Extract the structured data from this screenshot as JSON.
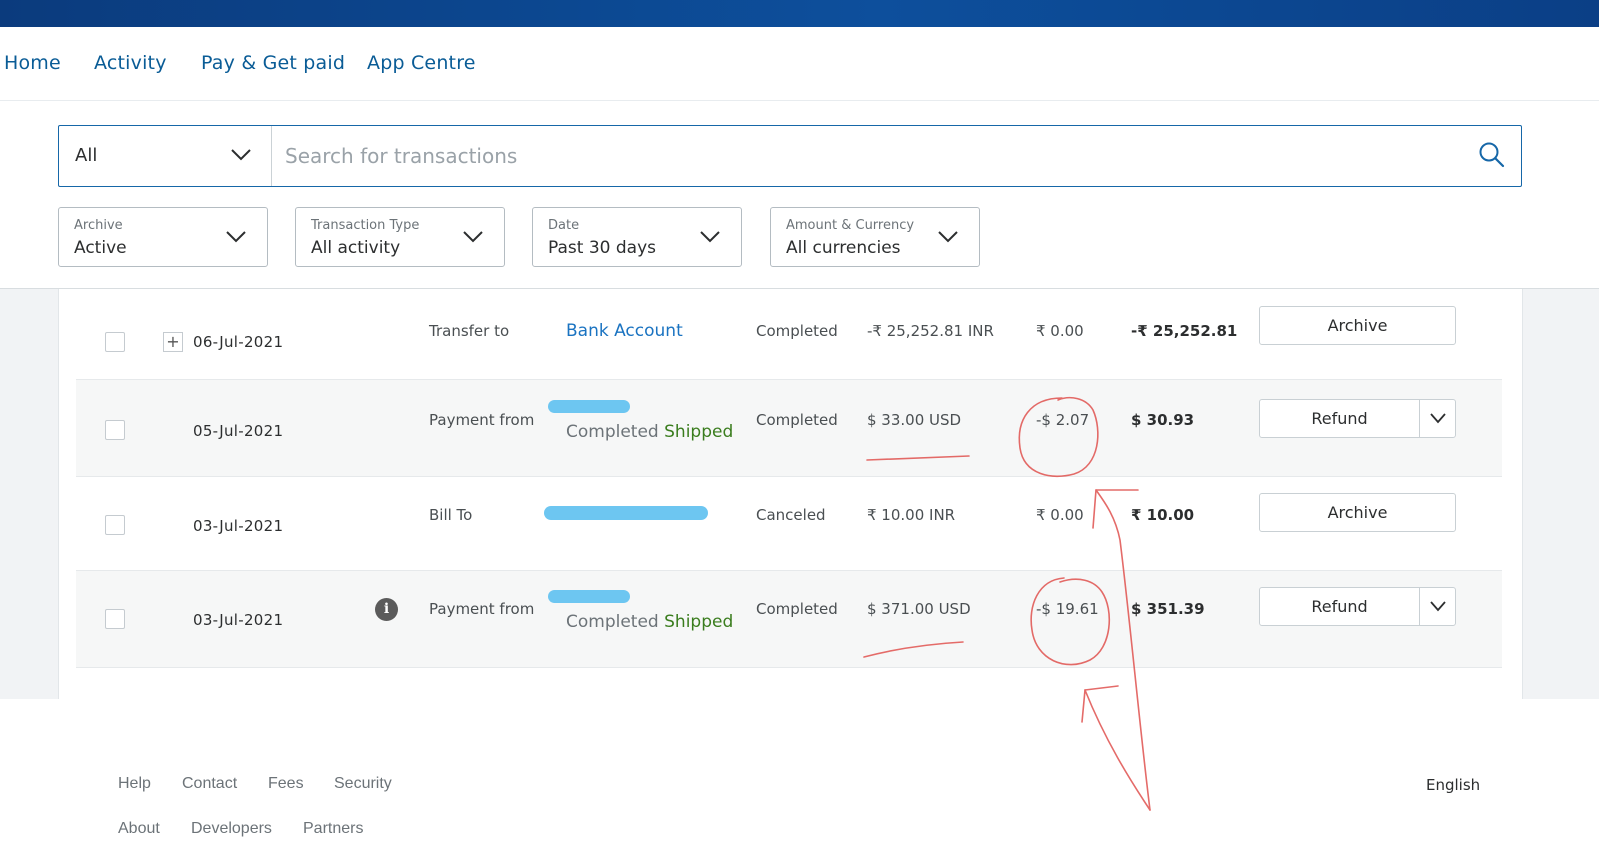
{
  "nav": {
    "items": [
      {
        "label": "Home"
      },
      {
        "label": "Activity"
      },
      {
        "label": "Pay & Get paid"
      },
      {
        "label": "App Centre"
      }
    ]
  },
  "search": {
    "scope_value": "All",
    "placeholder": "Search for transactions"
  },
  "filters": [
    {
      "label": "Archive",
      "value": "Active"
    },
    {
      "label": "Transaction Type",
      "value": "All activity"
    },
    {
      "label": "Date",
      "value": "Past 30 days"
    },
    {
      "label": "Amount & Currency",
      "value": "All currencies"
    }
  ],
  "transactions": [
    {
      "date": "06-Jul-2021",
      "type": "Transfer to",
      "party": "Bank Account",
      "status": "Completed",
      "gross": "-₹ 25,252.81 INR",
      "fee": "₹ 0.00",
      "net": "-₹ 25,252.81",
      "action": "Archive"
    },
    {
      "date": "05-Jul-2021",
      "type": "Payment from",
      "sub_status": "Completed",
      "shipping": "Shipped",
      "status": "Completed",
      "gross": "$ 33.00 USD",
      "fee": "-$ 2.07",
      "net": "$ 30.93",
      "action": "Refund"
    },
    {
      "date": "03-Jul-2021",
      "type": "Bill To",
      "status": "Canceled",
      "gross": "₹ 10.00 INR",
      "fee": "₹ 0.00",
      "net": "₹ 10.00",
      "action": "Archive"
    },
    {
      "date": "03-Jul-2021",
      "type": "Payment from",
      "sub_status": "Completed",
      "shipping": "Shipped",
      "status": "Completed",
      "gross": "$ 371.00 USD",
      "fee": "-$ 19.61",
      "net": "$ 351.39",
      "action": "Refund"
    }
  ],
  "footer": {
    "links_row1": [
      "Help",
      "Contact",
      "Fees",
      "Security"
    ],
    "links_row2": [
      "About",
      "Developers",
      "Partners"
    ],
    "language": "English"
  },
  "colors": {
    "brand_blue": "#0d4f9c",
    "link_blue": "#1a73c1",
    "shipped_green": "#3a7d1e",
    "annotation_red": "#e0524f"
  }
}
